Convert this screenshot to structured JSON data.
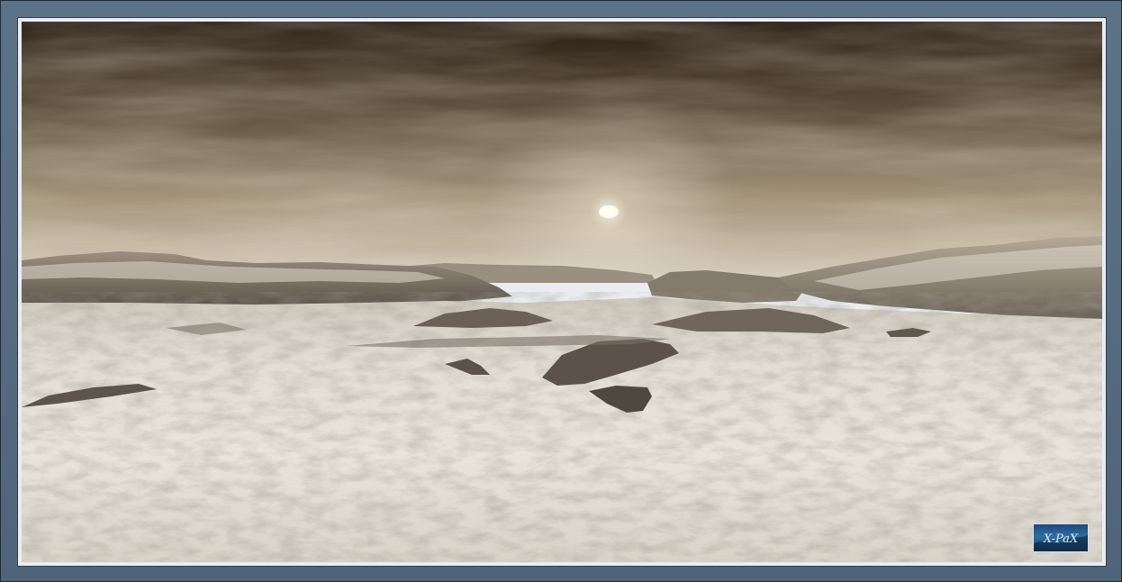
{
  "scene": {
    "frame_color": "#566c82",
    "mat_color": "#e9edf1",
    "sky_top": "#2a2014",
    "sky_mid": "#7b6b54",
    "sky_horizon": "#d6cdbd",
    "ground_light": "#e6e2da",
    "ground_shadow": "#6d655b",
    "sun_color": "#fffdf4"
  },
  "watermark": {
    "icon": "signature-logo-icon",
    "text": "X-PaX"
  }
}
